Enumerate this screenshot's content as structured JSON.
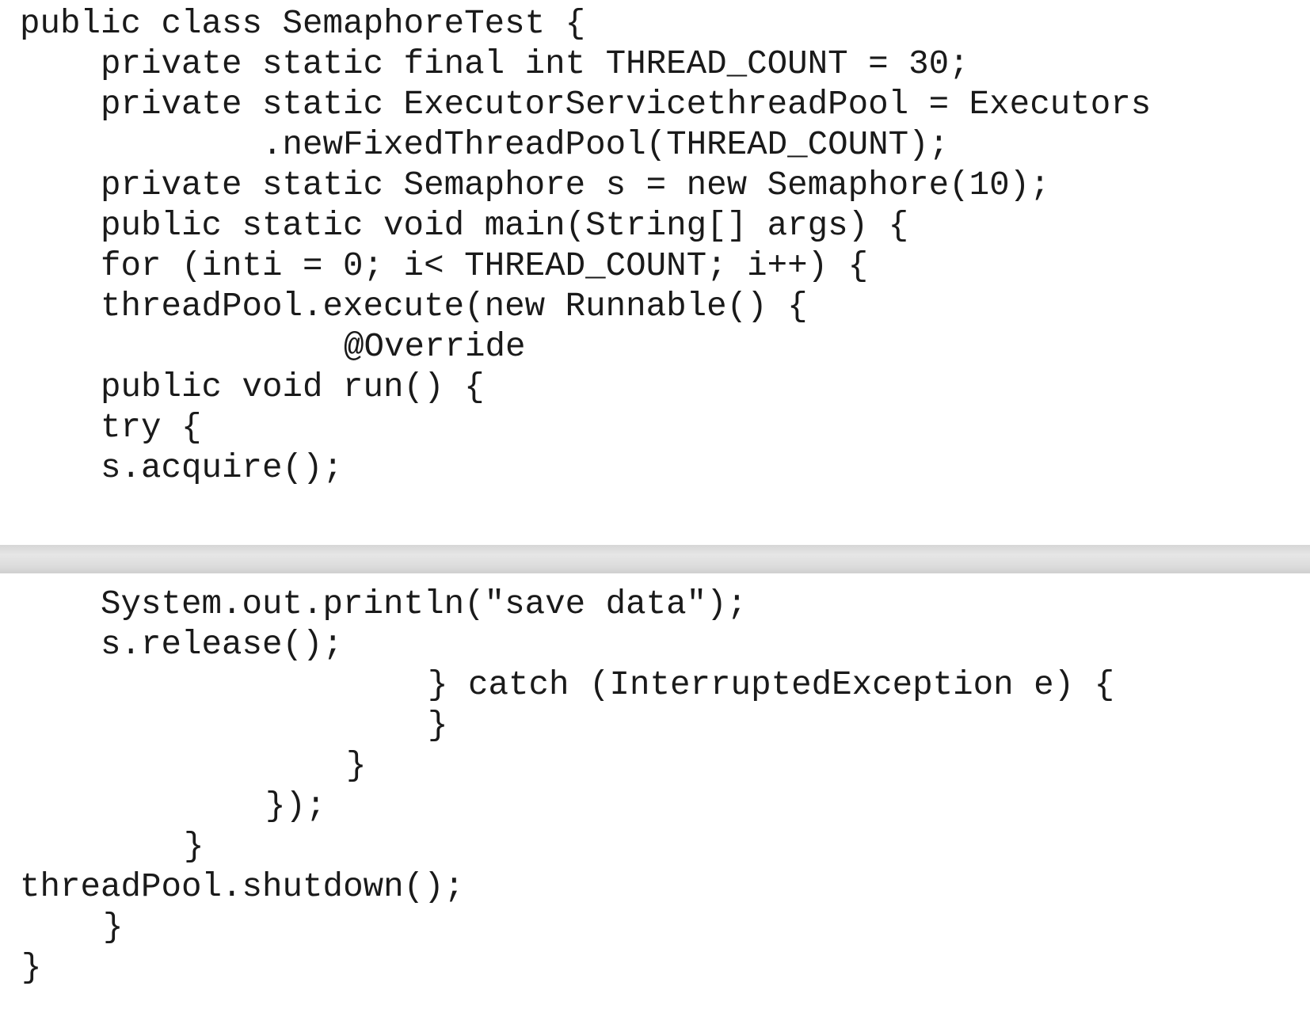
{
  "top_panel": {
    "lines": [
      "public class SemaphoreTest {",
      "private static final int THREAD_COUNT = 30;",
      "private static ExecutorServicethreadPool = Executors",
      ".newFixedThreadPool(THREAD_COUNT);",
      "private static Semaphore s = new Semaphore(10);",
      "public static void main(String[] args) {",
      "for (inti = 0; i< THREAD_COUNT; i++) {",
      "threadPool.execute(new Runnable() {",
      "@Override",
      "public void run() {",
      "try {",
      "s.acquire();"
    ]
  },
  "bottom_panel": {
    "lines": [
      "System.out.println(\"save data\");",
      "s.release();",
      "} catch (InterruptedException e) {",
      "}",
      "}",
      "});",
      "}",
      "threadPool.shutdown();",
      "}",
      "}"
    ]
  },
  "colors": {
    "text": "#1a1a1a",
    "background": "#ffffff",
    "separator": "#dcdcdc"
  }
}
